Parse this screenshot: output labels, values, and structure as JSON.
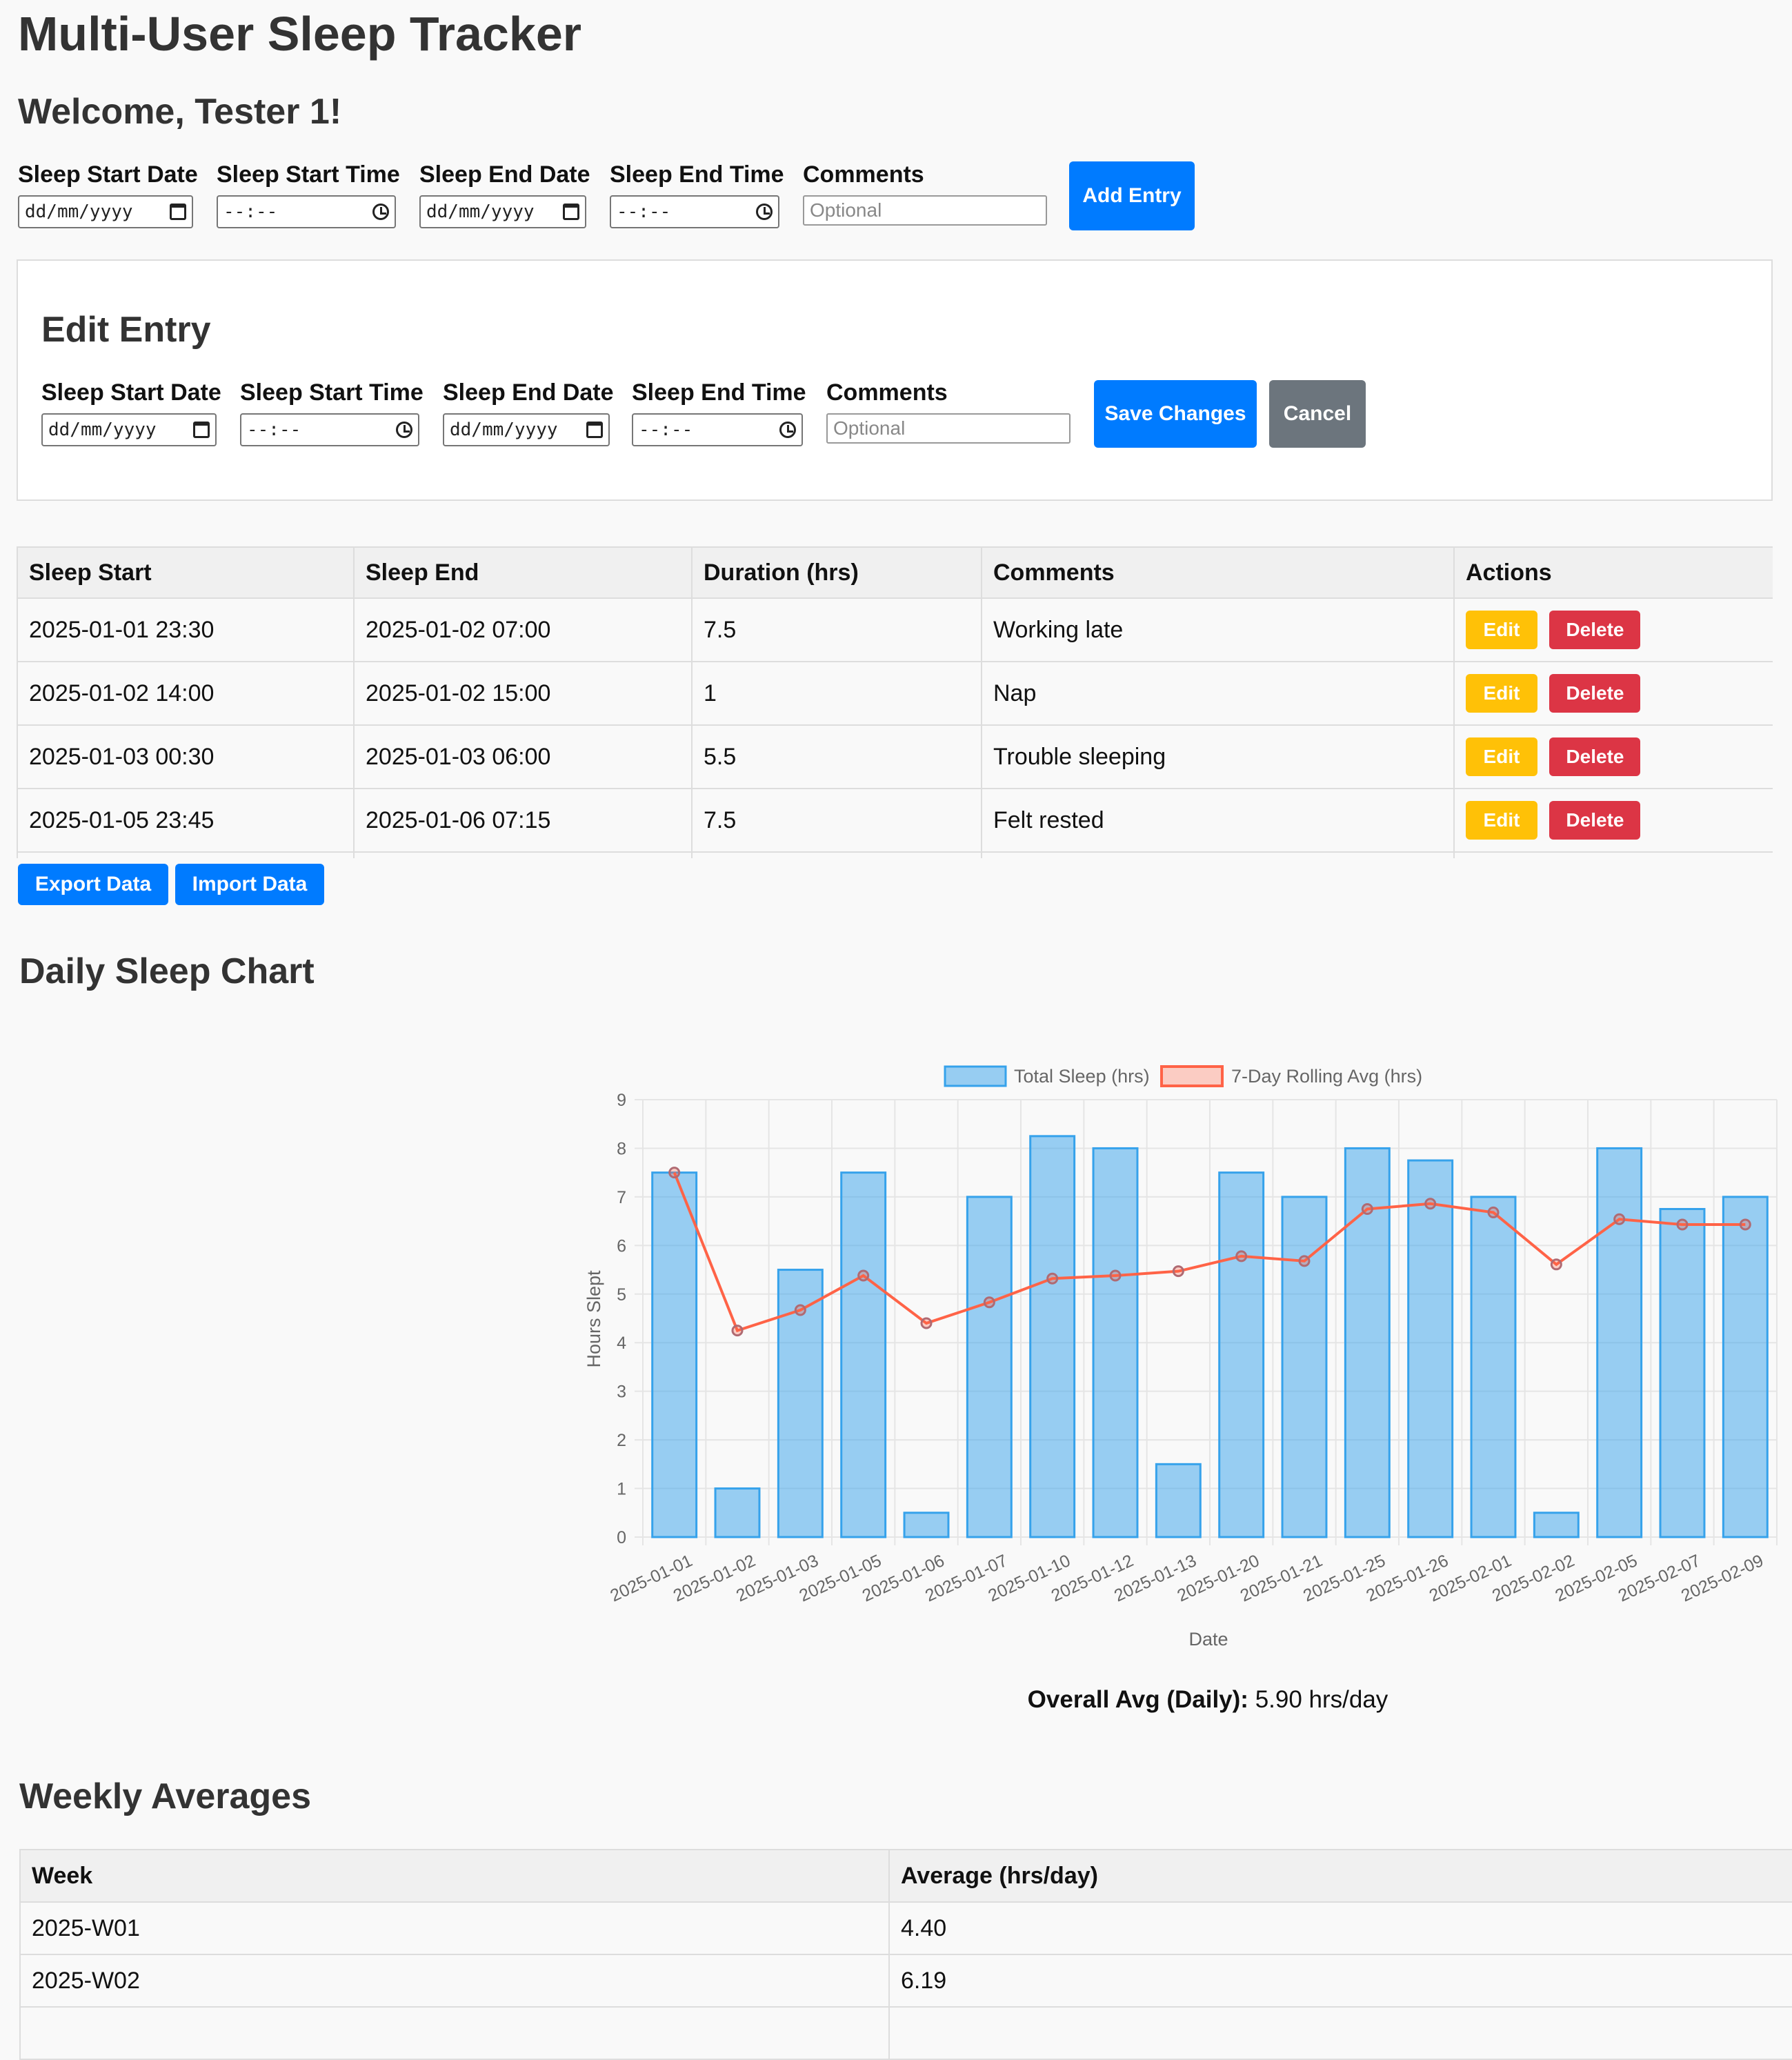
{
  "header": {
    "title": "Multi-User Sleep Tracker",
    "welcome": "Welcome, Tester 1!"
  },
  "add_form": {
    "start_date_label": "Sleep Start Date",
    "start_time_label": "Sleep Start Time",
    "end_date_label": "Sleep End Date",
    "end_time_label": "Sleep End Time",
    "comments_label": "Comments",
    "date_placeholder": "dd/mm/yyyy",
    "time_placeholder": "--:--",
    "comments_placeholder": "Optional",
    "submit_label": "Add Entry"
  },
  "edit_form": {
    "title": "Edit Entry",
    "start_date_label": "Sleep Start Date",
    "start_time_label": "Sleep Start Time",
    "end_date_label": "Sleep End Date",
    "end_time_label": "Sleep End Time",
    "comments_label": "Comments",
    "date_placeholder": "dd/mm/yyyy",
    "time_placeholder": "--:--",
    "comments_placeholder": "Optional",
    "save_label": "Save Changes",
    "cancel_label": "Cancel"
  },
  "entries_table": {
    "headers": [
      "Sleep Start",
      "Sleep End",
      "Duration (hrs)",
      "Comments",
      "Actions"
    ],
    "edit_label": "Edit",
    "delete_label": "Delete",
    "rows": [
      {
        "start": "2025-01-01 23:30",
        "end": "2025-01-02 07:00",
        "duration": "7.5",
        "comments": "Working late"
      },
      {
        "start": "2025-01-02 14:00",
        "end": "2025-01-02 15:00",
        "duration": "1",
        "comments": "Nap"
      },
      {
        "start": "2025-01-03 00:30",
        "end": "2025-01-03 06:00",
        "duration": "5.5",
        "comments": "Trouble sleeping"
      },
      {
        "start": "2025-01-05 23:45",
        "end": "2025-01-06 07:15",
        "duration": "7.5",
        "comments": "Felt rested"
      }
    ]
  },
  "data_buttons": {
    "export_label": "Export Data",
    "import_label": "Import Data"
  },
  "chart_section": {
    "title": "Daily Sleep Chart",
    "overall_label": "Overall Avg (Daily):",
    "overall_value": "5.90 hrs/day"
  },
  "chart_data": {
    "type": "bar",
    "xlabel": "Date",
    "ylabel": "Hours Slept",
    "ylim": [
      0,
      9
    ],
    "grid": true,
    "legend": "top",
    "categories": [
      "2025-01-01",
      "2025-01-02",
      "2025-01-03",
      "2025-01-05",
      "2025-01-06",
      "2025-01-07",
      "2025-01-10",
      "2025-01-12",
      "2025-01-13",
      "2025-01-20",
      "2025-01-21",
      "2025-01-25",
      "2025-01-26",
      "2025-02-01",
      "2025-02-02",
      "2025-02-05",
      "2025-02-07",
      "2025-02-09"
    ],
    "series": [
      {
        "name": "Total Sleep (hrs)",
        "type": "bar",
        "color": "#36a2eb",
        "values": [
          7.5,
          1,
          5.5,
          7.5,
          0.5,
          7,
          8.25,
          8,
          1.5,
          7.5,
          7,
          8,
          7.75,
          7,
          0.5,
          8,
          6.75,
          7
        ]
      },
      {
        "name": "7-Day Rolling Avg (hrs)",
        "type": "line",
        "color": "#ff6347",
        "values": [
          7.5,
          4.25,
          4.67,
          5.38,
          4.4,
          4.83,
          5.32,
          5.38,
          5.47,
          5.78,
          5.68,
          6.75,
          6.86,
          6.68,
          5.61,
          6.54,
          6.43,
          6.43
        ]
      }
    ]
  },
  "weekly": {
    "title": "Weekly Averages",
    "headers": [
      "Week",
      "Average (hrs/day)"
    ],
    "rows": [
      {
        "week": "2025-W01",
        "avg": "4.40"
      },
      {
        "week": "2025-W02",
        "avg": "6.19"
      }
    ]
  }
}
